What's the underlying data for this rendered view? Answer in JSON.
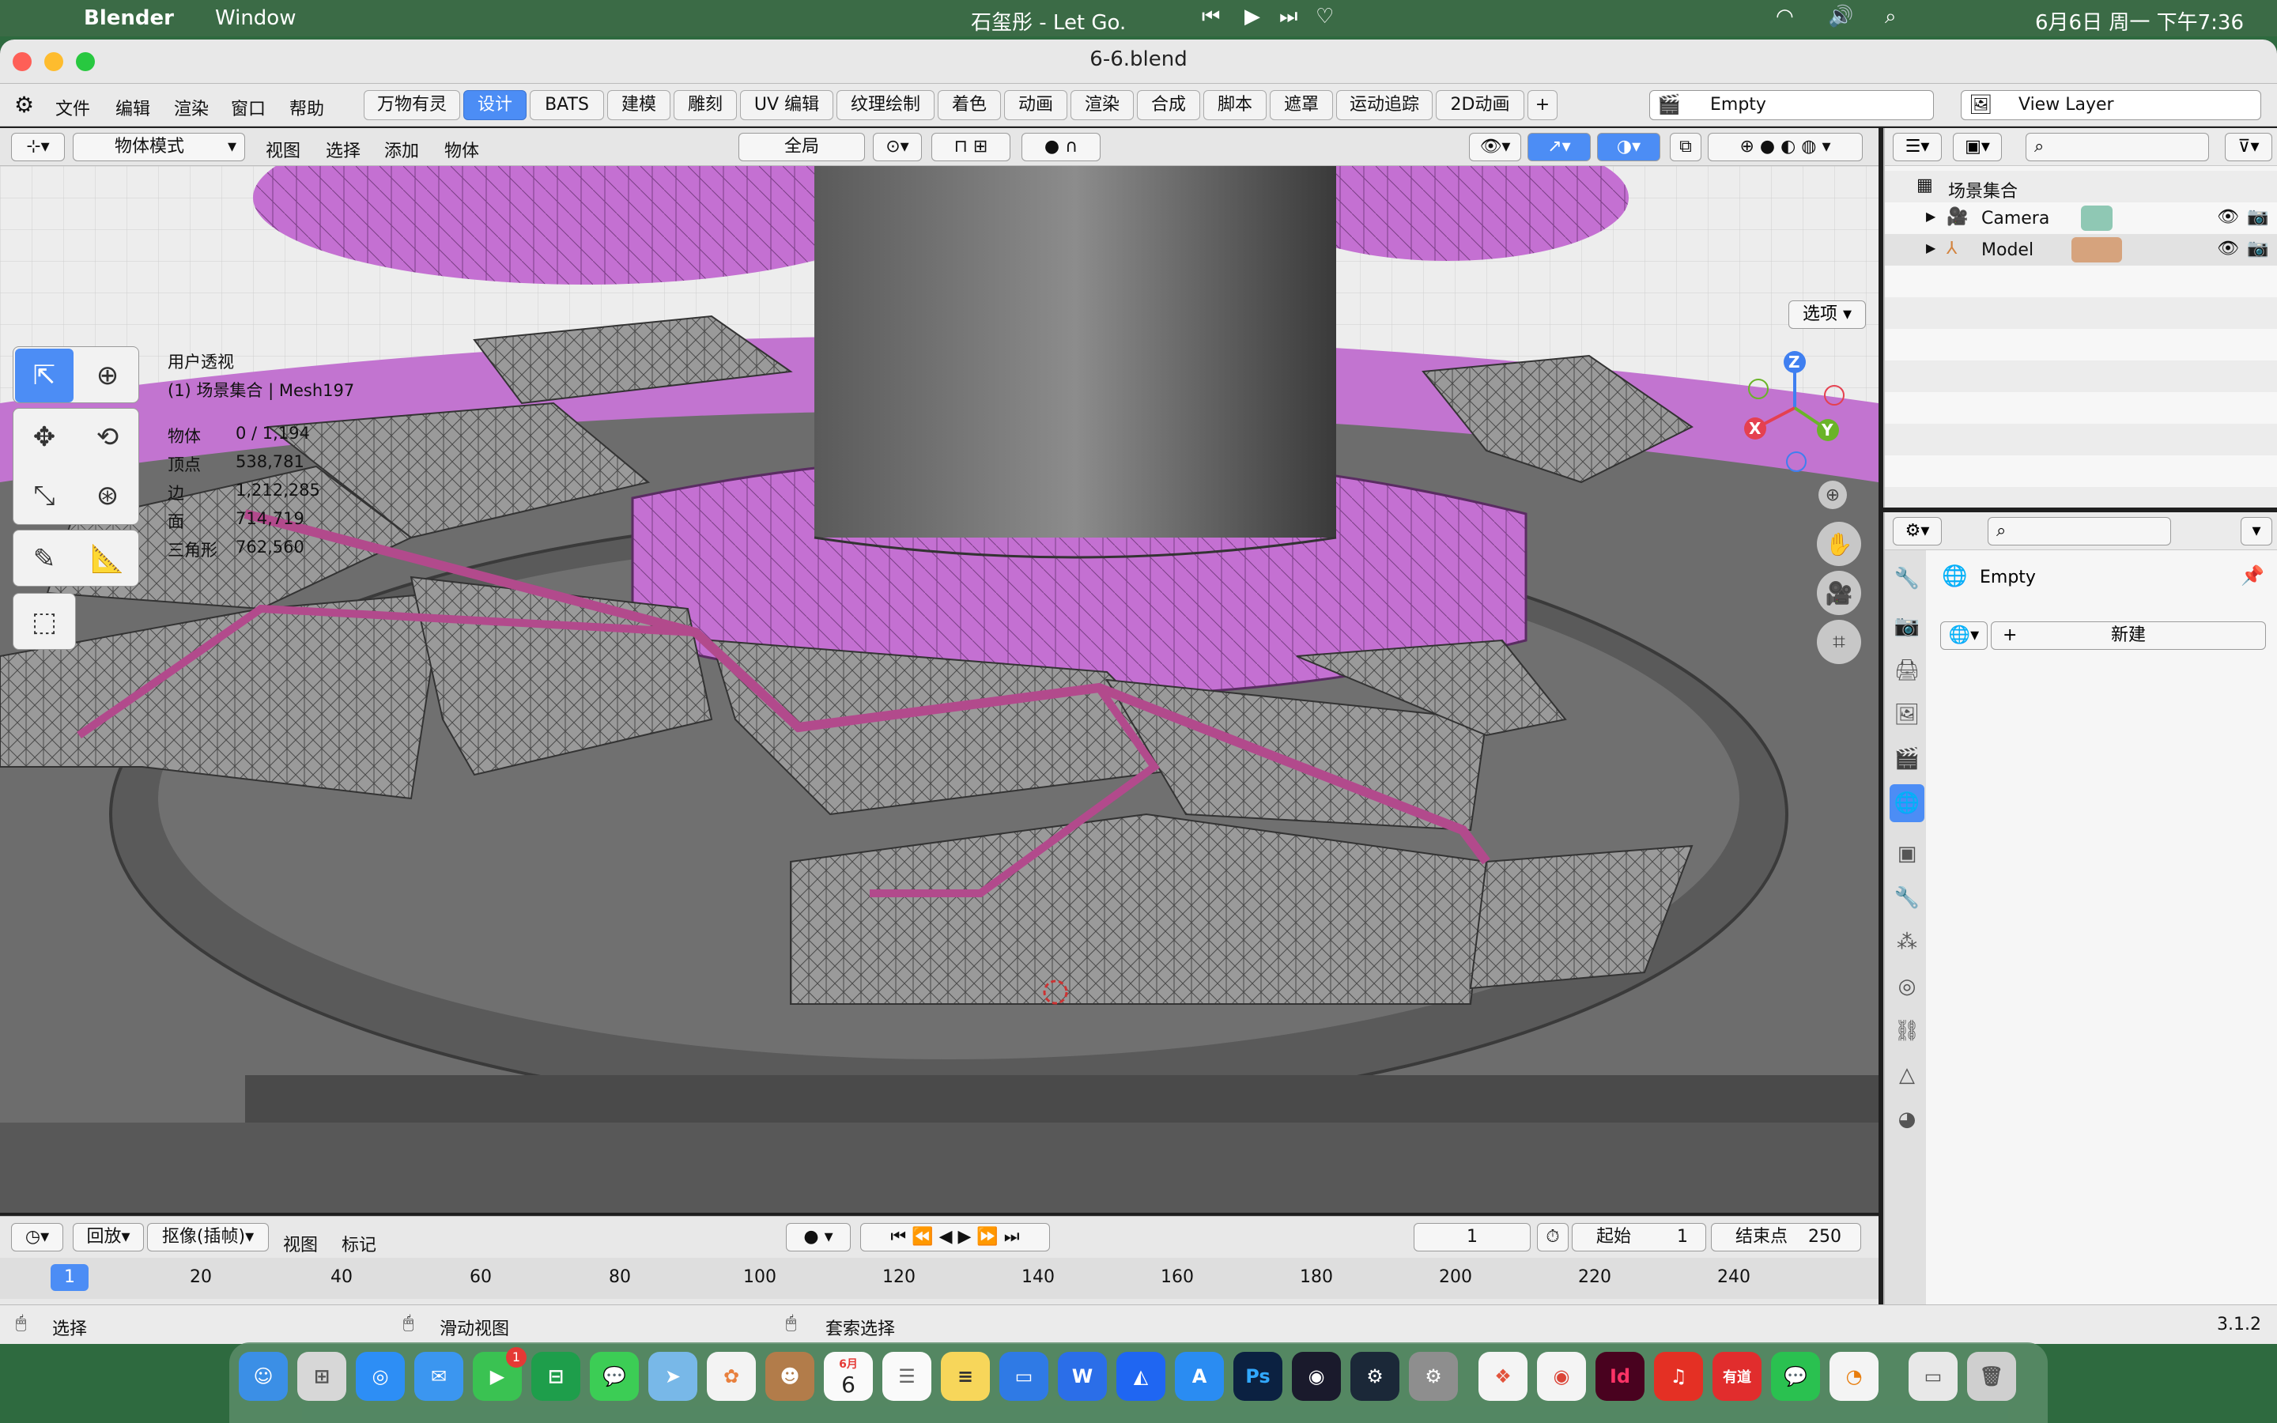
{
  "menubar": {
    "app_name": "Blender",
    "window_menu": "Window",
    "now_playing": "石玺彤 - Let Go.",
    "datetime": "6月6日 周一 下午7:36"
  },
  "window": {
    "title": "6-6.blend"
  },
  "topbar": {
    "menus": [
      "文件",
      "编辑",
      "渲染",
      "窗口",
      "帮助"
    ],
    "workspaces": [
      "万物有灵",
      "设计",
      "BATS",
      "建模",
      "雕刻",
      "UV 编辑",
      "纹理绘制",
      "着色",
      "动画",
      "渲染",
      "合成",
      "脚本",
      "遮罩",
      "运动追踪",
      "2D动画"
    ],
    "active_workspace": "设计",
    "add_tab": "+",
    "scene_name": "Empty",
    "view_layer": "View Layer"
  },
  "viewport_header": {
    "mode": "物体模式",
    "menus": [
      "视图",
      "选择",
      "添加",
      "物体"
    ],
    "orientation": "全局",
    "options_label": "选项"
  },
  "viewport_overlay": {
    "view_name": "用户透视",
    "collection_line": "(1) 场景集合 | Mesh197",
    "stats": [
      {
        "label": "物体",
        "value": "0 / 1,194"
      },
      {
        "label": "顶点",
        "value": "538,781"
      },
      {
        "label": "边",
        "value": "1,212,285"
      },
      {
        "label": "面",
        "value": "714,719"
      },
      {
        "label": "三角形",
        "value": "762,560"
      }
    ],
    "gizmo": {
      "z": "Z",
      "x": "X",
      "y": "Y"
    }
  },
  "outliner": {
    "root": "场景集合",
    "items": [
      {
        "name": "Camera"
      },
      {
        "name": "Model"
      }
    ]
  },
  "properties": {
    "world_name": "Empty",
    "new_button": "新建"
  },
  "timeline": {
    "playback": "回放",
    "keying": "抠像(插帧)",
    "view": "视图",
    "marker": "标记",
    "current_frame": "1",
    "start_label": "起始",
    "start_value": "1",
    "end_label": "结束点",
    "end_value": "250",
    "ruler_current": "1",
    "ticks": [
      "20",
      "40",
      "60",
      "80",
      "100",
      "120",
      "140",
      "160",
      "180",
      "200",
      "220",
      "240"
    ]
  },
  "statusbar": {
    "select": "选择",
    "pan": "滑动视图",
    "lasso": "套索选择",
    "version": "3.1.2"
  },
  "dock": {
    "calendar_month": "6月",
    "calendar_day": "6",
    "facetime_badge": "1",
    "ps_label": "Ps",
    "id_label": "Id",
    "youdao_label": "有道"
  },
  "colors": {
    "accent": "#4c8df5",
    "magenta_mesh": "#c86ed6",
    "mesh_gray": "#8a8a8a"
  }
}
